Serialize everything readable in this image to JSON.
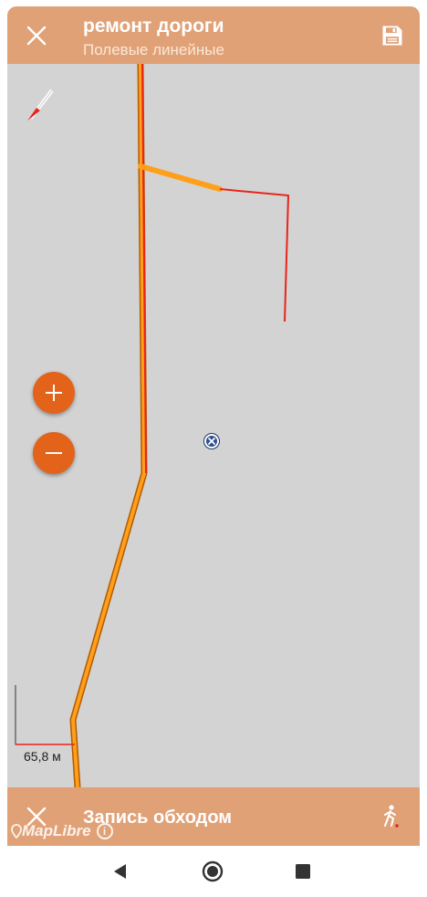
{
  "topbar": {
    "title": "ремонт дороги",
    "subtitle": "Полевые линейные",
    "close_icon": "close-icon",
    "save_icon": "save-icon"
  },
  "map": {
    "scale_label": "65,8 м",
    "attribution": "MapLibre",
    "marker_label": "X",
    "compass_icon": "compass-icon",
    "zoom_in_icon": "plus-icon",
    "zoom_out_icon": "minus-icon"
  },
  "bottombar": {
    "label": "Запись обходом",
    "close_icon": "close-icon",
    "mode_icon": "walking-person-icon"
  },
  "colors": {
    "toolbar": "#e0a177",
    "map_background": "#d3d3d3",
    "route_orange": "#ff9f1a",
    "route_outline": "#b35a00",
    "track_red": "#e8251b",
    "zoom_button": "#e3631b"
  }
}
